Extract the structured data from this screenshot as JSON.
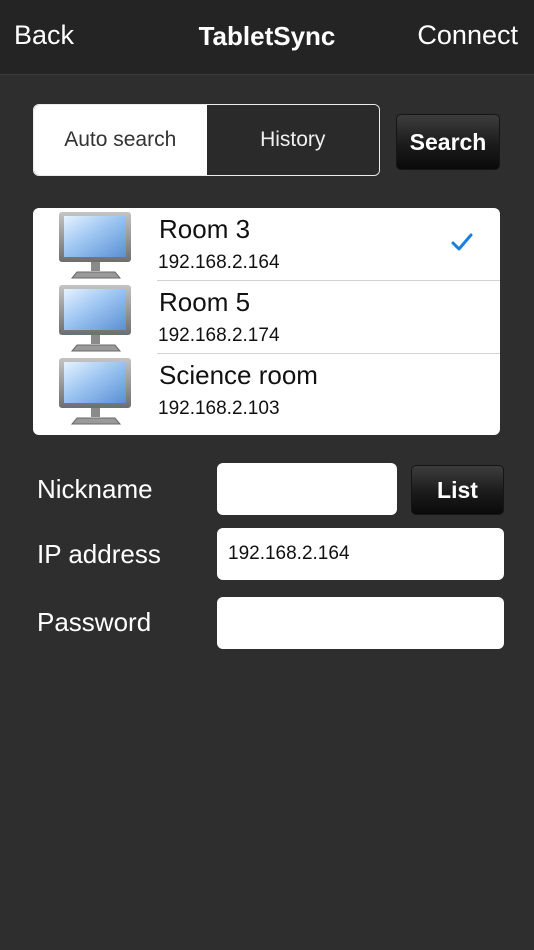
{
  "navbar": {
    "back_label": "Back",
    "title": "TabletSync",
    "connect_label": "Connect"
  },
  "search_mode": {
    "tabs": [
      {
        "label": "Auto search",
        "selected": true
      },
      {
        "label": "History",
        "selected": false
      }
    ],
    "search_button_label": "Search"
  },
  "devices": [
    {
      "name": "Room 3",
      "ip": "192.168.2.164",
      "selected": true
    },
    {
      "name": "Room 5",
      "ip": "192.168.2.174",
      "selected": false
    },
    {
      "name": "Science room",
      "ip": "192.168.2.103",
      "selected": false
    }
  ],
  "form": {
    "nickname_label": "Nickname",
    "nickname_value": "",
    "list_button_label": "List",
    "ip_label": "IP address",
    "ip_value": "192.168.2.164",
    "password_label": "Password",
    "password_value": ""
  },
  "colors": {
    "background": "#2e2e2e",
    "navbar": "#242424",
    "checkmark": "#1a7fe0"
  },
  "icons": {
    "device": "monitor-icon",
    "selected": "checkmark-icon"
  }
}
